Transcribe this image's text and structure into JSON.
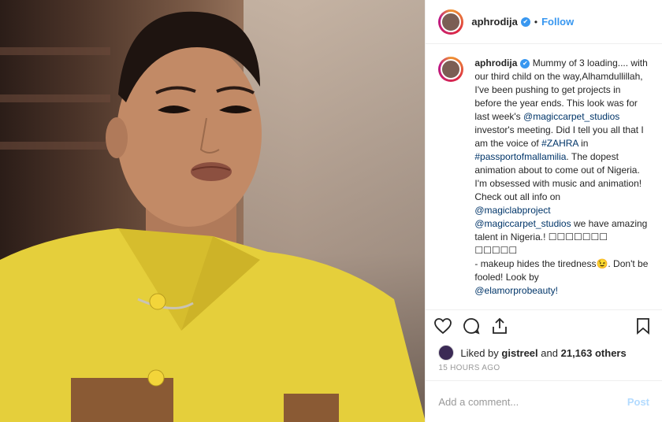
{
  "post": {
    "username": "aphrodija",
    "follow_label": "Follow",
    "verified_glyph": "✔",
    "caption": {
      "username": "aphrodija",
      "part1": " Mummy of 3 loading.... with our third child on the way,Alhamdullillah, I've been pushing to get projects in before the year ends. This look was for last week's ",
      "link1": "@magiccarpet_studios",
      "part2": " investor's meeting. Did I tell you all that I am the voice of ",
      "link2": "#ZAHRA",
      "part3": " in ",
      "link3": "#passportofmallamilia",
      "part4": ". The dopest animation about to come out of Nigeria. I'm obsessed with music and animation! Check out all info on ",
      "link4": "@magiclabproject",
      "space": " ",
      "link5": "@magiccarpet_studios",
      "part5": " we have amazing talent in Nigeria.! ☐☐☐☐☐☐☐ ☐☐☐☐☐",
      "part6": "- makeup hides the tiredness😉. Don't be fooled! Look by ",
      "link6": "@elamorprobeauty!"
    },
    "likes": {
      "prefix": "Liked by",
      "user": "gistreel",
      "and": "and",
      "count": "21,163 others"
    },
    "time": "15 HOURS AGO",
    "comment_placeholder": "Add a comment...",
    "post_label": "Post"
  },
  "icons": {
    "like": "heart-icon",
    "comment": "comment-icon",
    "share": "share-icon",
    "save": "bookmark-icon"
  },
  "colors": {
    "link": "#003569",
    "follow": "#3897f0",
    "post_disabled": "#b3dbff",
    "muted": "#999999"
  }
}
